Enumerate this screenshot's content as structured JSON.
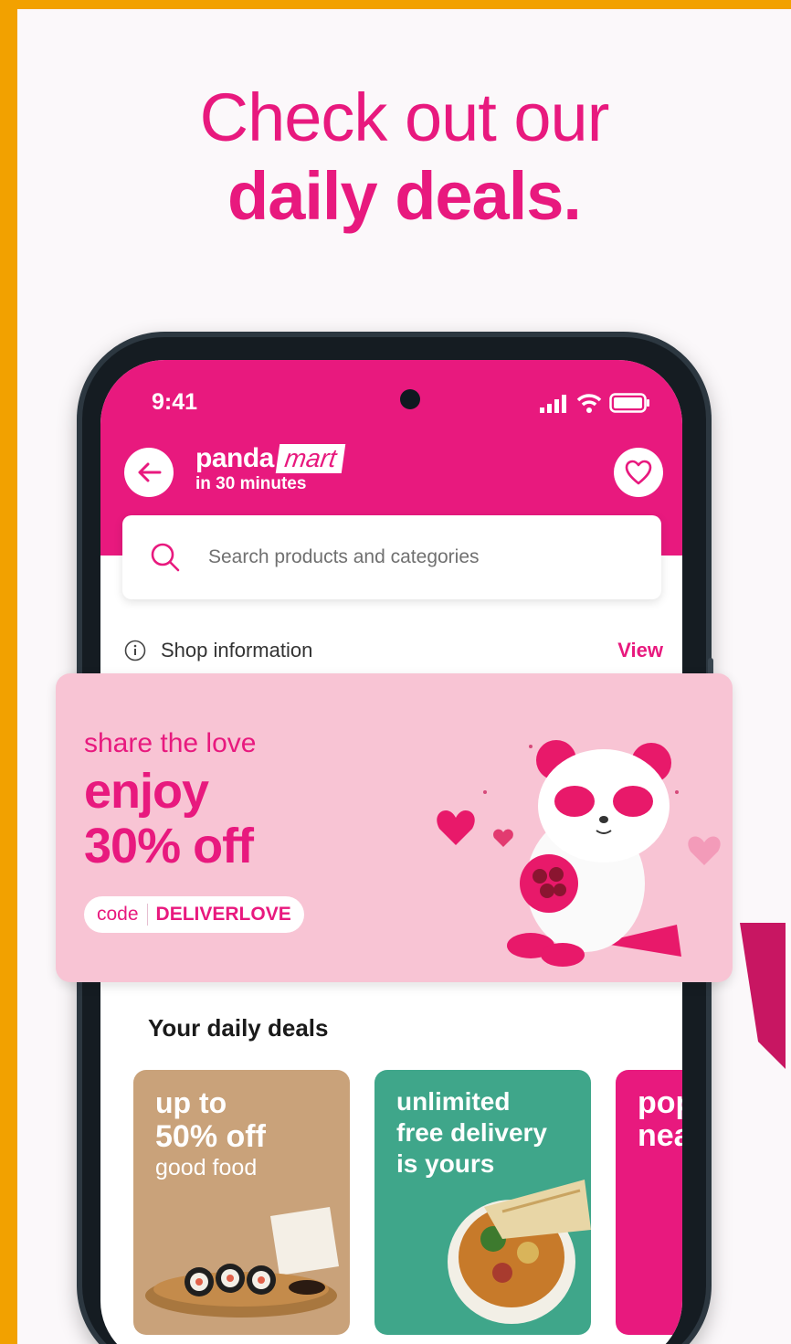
{
  "headline": {
    "line1": "Check out our",
    "line2": "daily deals."
  },
  "status_bar": {
    "time": "9:41"
  },
  "app_header": {
    "brand_name": "panda",
    "brand_tag": "mart",
    "brand_subtitle": "in 30 minutes"
  },
  "search": {
    "placeholder": "Search products and categories"
  },
  "shop_info": {
    "label": "Shop information",
    "action": "View"
  },
  "promo_banner": {
    "tagline": "share the love",
    "line1": "enjoy",
    "line2": "30% off",
    "code_label": "code",
    "code_value": "DELIVERLOVE"
  },
  "daily_deals": {
    "title": "Your daily deals",
    "cards": [
      {
        "line1": "up to",
        "line2": "50% off",
        "line3": "good food"
      },
      {
        "line1": "unlimited",
        "line2": "free delivery",
        "line3": "is yours"
      },
      {
        "line1": "pop",
        "line2": "nea"
      }
    ]
  },
  "colors": {
    "brand_pink": "#e8197e",
    "banner_pink": "#f8c4d4",
    "frame_orange": "#f2a100"
  }
}
